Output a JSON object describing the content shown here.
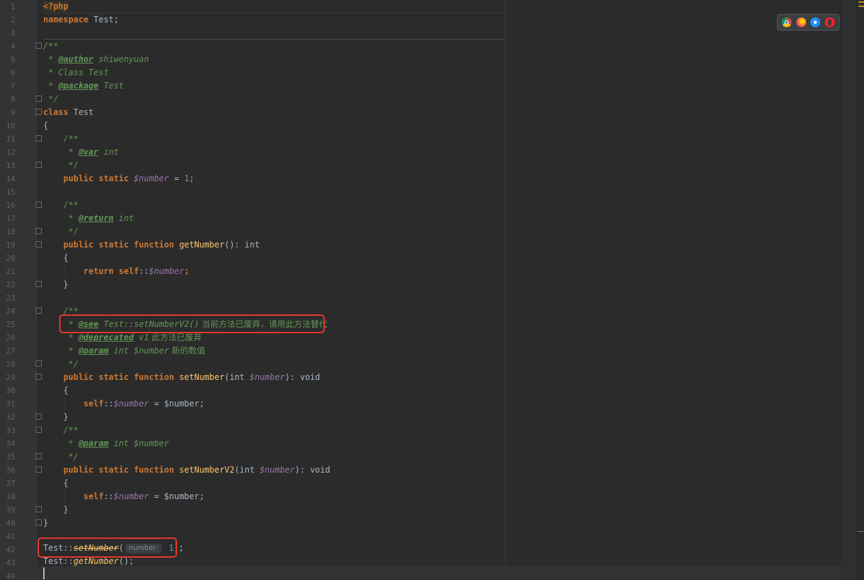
{
  "editor": {
    "language": "php",
    "line_numbers": [
      "1",
      "2",
      "3",
      "4",
      "5",
      "6",
      "7",
      "8",
      "9",
      "10",
      "11",
      "12",
      "13",
      "14",
      "15",
      "16",
      "17",
      "18",
      "19",
      "20",
      "21",
      "22",
      "23",
      "24",
      "25",
      "26",
      "27",
      "28",
      "29",
      "30",
      "31",
      "32",
      "33",
      "34",
      "35",
      "36",
      "37",
      "38",
      "39",
      "40",
      "41",
      "42",
      "43",
      "44"
    ],
    "code": {
      "l1": "<?php",
      "l2_kw": "namespace",
      "l2_name": " Test;",
      "l4": "/**",
      "l5_pre": " * ",
      "l5_tag": "@author",
      "l5_post": " shiwenyuan",
      "l6": " * Class Test",
      "l7_pre": " * ",
      "l7_tag": "@package",
      "l7_post": " Test",
      "l8": " */",
      "l9_kw": "class",
      "l9_name": " Test",
      "l10": "{",
      "l11": "    /**",
      "l12_pre": "     * ",
      "l12_tag": "@var",
      "l12_post": " int",
      "l13": "     */",
      "l14_kw": "    public static ",
      "l14_var": "$number",
      "l14_eq": " = ",
      "l14_num": "1",
      "l14_end": ";",
      "l16": "    /**",
      "l17_pre": "     * ",
      "l17_tag": "@return",
      "l17_post": " int",
      "l18": "     */",
      "l19_kw": "    public static function ",
      "l19_fn": "getNumber",
      "l19_rest": "(): int",
      "l20": "    {",
      "l21_kw": "        return self",
      "l21_sep": "::",
      "l21_var": "$number",
      "l21_end": ";",
      "l22": "    }",
      "l24": "    /**",
      "l25_pre": "     * ",
      "l25_tag": "@see",
      "l25_ref": " Test::setNumberV2()",
      "l25_cn": " 当前方法已废弃，请用此方法替代",
      "l26_pre": "     * ",
      "l26_tag": "@deprecated",
      "l26_ver": " v1",
      "l26_cn": " 此方法已废弃",
      "l27_pre": "     * ",
      "l27_tag": "@param",
      "l27_type": " int $number",
      "l27_cn": " 新的数值",
      "l28": "     */",
      "l29_kw": "    public static function ",
      "l29_fn": "setNumber",
      "l29_p1": "(int ",
      "l29_var": "$number",
      "l29_p2": "): void",
      "l30": "    {",
      "l31_kw": "        self",
      "l31_sep": "::",
      "l31_var": "$number",
      "l31_rest": " = $number;",
      "l32": "    }",
      "l33": "    /**",
      "l34_pre": "     * ",
      "l34_tag": "@param",
      "l34_post": " int $number",
      "l35": "     */",
      "l36_kw": "    public static function ",
      "l36_fn": "setNumberV2",
      "l36_p1": "(int ",
      "l36_var": "$number",
      "l36_p2": "): void",
      "l37": "    {",
      "l38_kw": "        self",
      "l38_sep": "::",
      "l38_var": "$number",
      "l38_rest": " = $number;",
      "l39": "    }",
      "l40": "}",
      "l42_cls": "Test::",
      "l42_fn": "setNumber",
      "l42_open": "(",
      "l42_hint": "number:",
      "l42_val": " 1",
      "l42_end": ");",
      "l43_cls": "Test::",
      "l43_fn": "getNumber",
      "l43_end": "();"
    }
  },
  "browser_icons": [
    "chrome-icon",
    "firefox-icon",
    "safari-icon",
    "opera-icon"
  ],
  "colors": {
    "background": "#2b2b2b",
    "keyword": "#cc7832",
    "doc_comment": "#629755",
    "variable": "#9876aa",
    "number": "#6897bb",
    "function": "#ffc66d",
    "highlight_box": "#e8382f"
  }
}
